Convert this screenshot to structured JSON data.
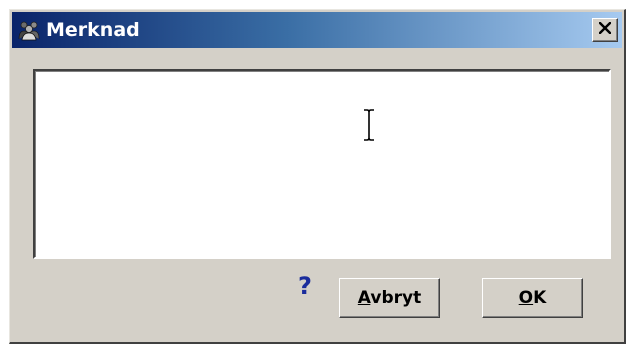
{
  "window": {
    "title": "Merknad",
    "icon": "users-group-icon",
    "close_icon": "close-x-icon"
  },
  "note": {
    "value": ""
  },
  "footer": {
    "help_label": "?",
    "cancel_label": "Avbryt",
    "ok_label": "OK"
  },
  "colors": {
    "titlebar_start": "#0a246a",
    "titlebar_end": "#a6caf0",
    "face": "#d4d0c8",
    "help": "#1a2c9c"
  }
}
